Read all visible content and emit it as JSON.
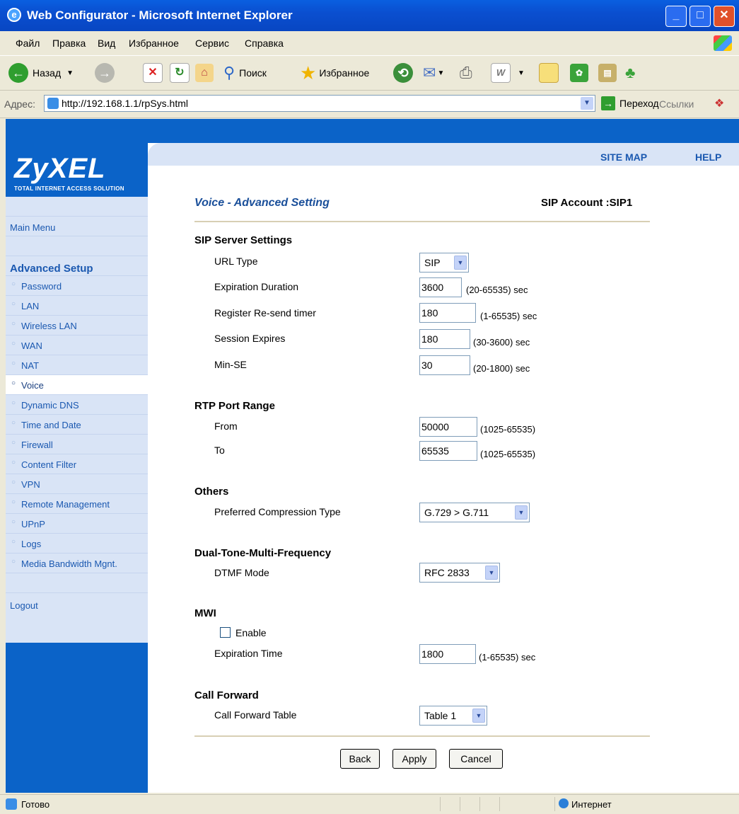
{
  "window": {
    "title": "Web Configurator - Microsoft Internet Explorer"
  },
  "menu": [
    "Файл",
    "Правка",
    "Вид",
    "Избранное",
    "Сервис",
    "Справка"
  ],
  "toolbar": {
    "back": "Назад",
    "search": "Поиск",
    "favorites": "Избранное"
  },
  "address": {
    "label": "Адрес:",
    "url": "http://192.168.1.1/rpSys.html",
    "go": "Переход",
    "links": "Ссылки"
  },
  "logo": {
    "name": "ZyXEL",
    "tagline": "TOTAL INTERNET ACCESS SOLUTION"
  },
  "header": {
    "site_map": "SITE MAP",
    "help": "HELP"
  },
  "sidebar": {
    "main_menu": "Main Menu",
    "advanced_setup": "Advanced Setup",
    "items": [
      "Password",
      "LAN",
      "Wireless LAN",
      "WAN",
      "NAT",
      "Voice",
      "Dynamic DNS",
      "Time and Date",
      "Firewall",
      "Content Filter",
      "VPN",
      "Remote Management",
      "UPnP",
      "Logs",
      "Media Bandwidth Mgnt."
    ],
    "selected": "Voice",
    "logout": "Logout"
  },
  "page": {
    "title": "Voice - Advanced Setting",
    "sip_account": "SIP Account :SIP1"
  },
  "sip_server": {
    "heading": "SIP Server Settings",
    "url_type": {
      "label": "URL Type",
      "value": "SIP"
    },
    "expiration": {
      "label": "Expiration Duration",
      "value": "3600",
      "unit": "(20-65535) sec"
    },
    "register": {
      "label": "Register Re-send timer",
      "value": "180",
      "unit": "(1-65535) sec"
    },
    "session": {
      "label": "Session Expires",
      "value": "180",
      "unit": "(30-3600) sec"
    },
    "minse": {
      "label": "Min-SE",
      "value": "30",
      "unit": "(20-1800) sec"
    }
  },
  "rtp": {
    "heading": "RTP Port Range",
    "from": {
      "label": "From",
      "value": "50000",
      "unit": "(1025-65535)"
    },
    "to": {
      "label": "To",
      "value": "65535",
      "unit": "(1025-65535)"
    }
  },
  "others": {
    "heading": "Others",
    "compression": {
      "label": "Preferred Compression Type",
      "value": "G.729 > G.711"
    }
  },
  "dtmf": {
    "heading": "Dual-Tone-Multi-Frequency",
    "mode": {
      "label": "DTMF Mode",
      "value": "RFC 2833"
    }
  },
  "mwi": {
    "heading": "MWI",
    "enable_label": "Enable",
    "enabled": false,
    "expiration": {
      "label": "Expiration Time",
      "value": "1800",
      "unit": "(1-65535) sec"
    }
  },
  "call_forward": {
    "heading": "Call Forward",
    "table": {
      "label": "Call Forward Table",
      "value": "Table 1"
    }
  },
  "buttons": {
    "back": "Back",
    "apply": "Apply",
    "cancel": "Cancel"
  },
  "status": {
    "left": "Готово",
    "zone": "Интернет"
  }
}
